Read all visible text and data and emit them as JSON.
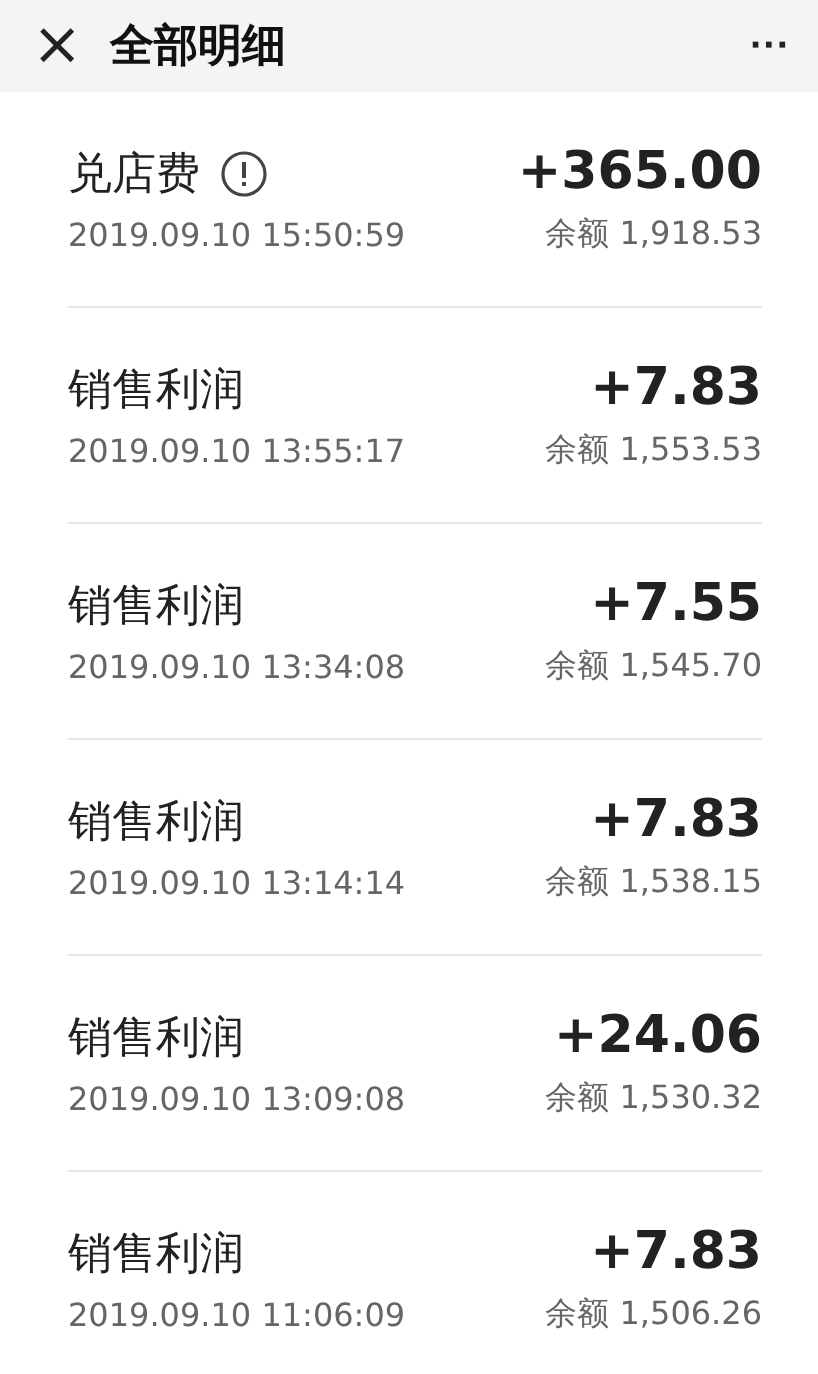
{
  "header": {
    "close": "×",
    "title": "全部明细",
    "more": "···"
  },
  "entries": [
    {
      "title": "兑店费",
      "info": true,
      "time": "2019.09.10 15:50:59",
      "amount": "+365.00",
      "balance": "余额 1,918.53"
    },
    {
      "title": "销售利润",
      "info": false,
      "time": "2019.09.10 13:55:17",
      "amount": "+7.83",
      "balance": "余额 1,553.53"
    },
    {
      "title": "销售利润",
      "info": false,
      "time": "2019.09.10 13:34:08",
      "amount": "+7.55",
      "balance": "余额 1,545.70"
    },
    {
      "title": "销售利润",
      "info": false,
      "time": "2019.09.10 13:14:14",
      "amount": "+7.83",
      "balance": "余额 1,538.15"
    },
    {
      "title": "销售利润",
      "info": false,
      "time": "2019.09.10 13:09:08",
      "amount": "+24.06",
      "balance": "余额 1,530.32"
    },
    {
      "title": "销售利润",
      "info": false,
      "time": "2019.09.10 11:06:09",
      "amount": "+7.83",
      "balance": "余额 1,506.26"
    }
  ]
}
